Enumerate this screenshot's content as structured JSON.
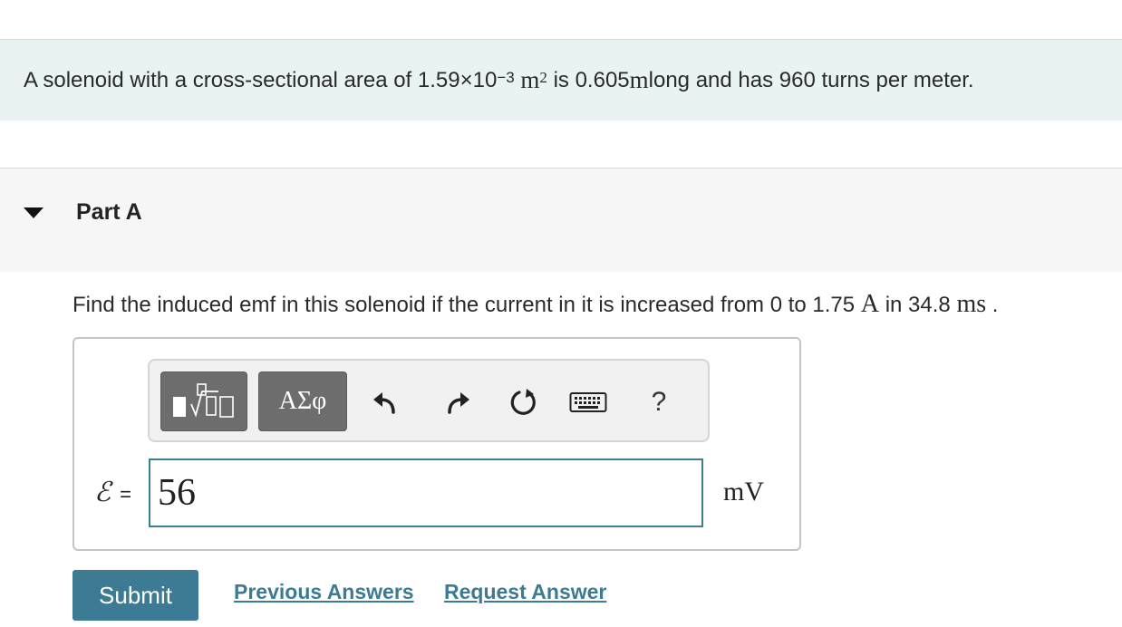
{
  "problem": {
    "text_1": "A solenoid with a cross-sectional area of 1.59×10",
    "exponent_1": "−3",
    "unit_area": "m",
    "exponent_2": "2",
    "text_2": " is 0.605 ",
    "unit_length": "m",
    "text_3": " long and has 960 turns per meter."
  },
  "part": {
    "title": "Part A"
  },
  "question": {
    "text_1": "Find the induced emf in this solenoid if the current in it is increased from 0 to 1.75 ",
    "unit_current": "A",
    "text_2": " in 34.8 ",
    "unit_time": "ms",
    "text_3": " ."
  },
  "toolbar": {
    "templates_icon": "templates-icon",
    "greek_label": "ΑΣφ",
    "undo_icon": "undo-icon",
    "redo_icon": "redo-icon",
    "reset_icon": "reset-icon",
    "keyboard_icon": "keyboard-icon",
    "help_label": "?"
  },
  "answer": {
    "variable": "ℰ",
    "equals": "=",
    "value": "56",
    "unit": "mV"
  },
  "actions": {
    "submit_label": "Submit",
    "previous_answers_label": "Previous Answers",
    "request_answer_label": "Request Answer"
  },
  "colors": {
    "accent": "#3d7b94",
    "problem_bg": "#e9f3f4",
    "part_bg": "#f6f6f6"
  }
}
